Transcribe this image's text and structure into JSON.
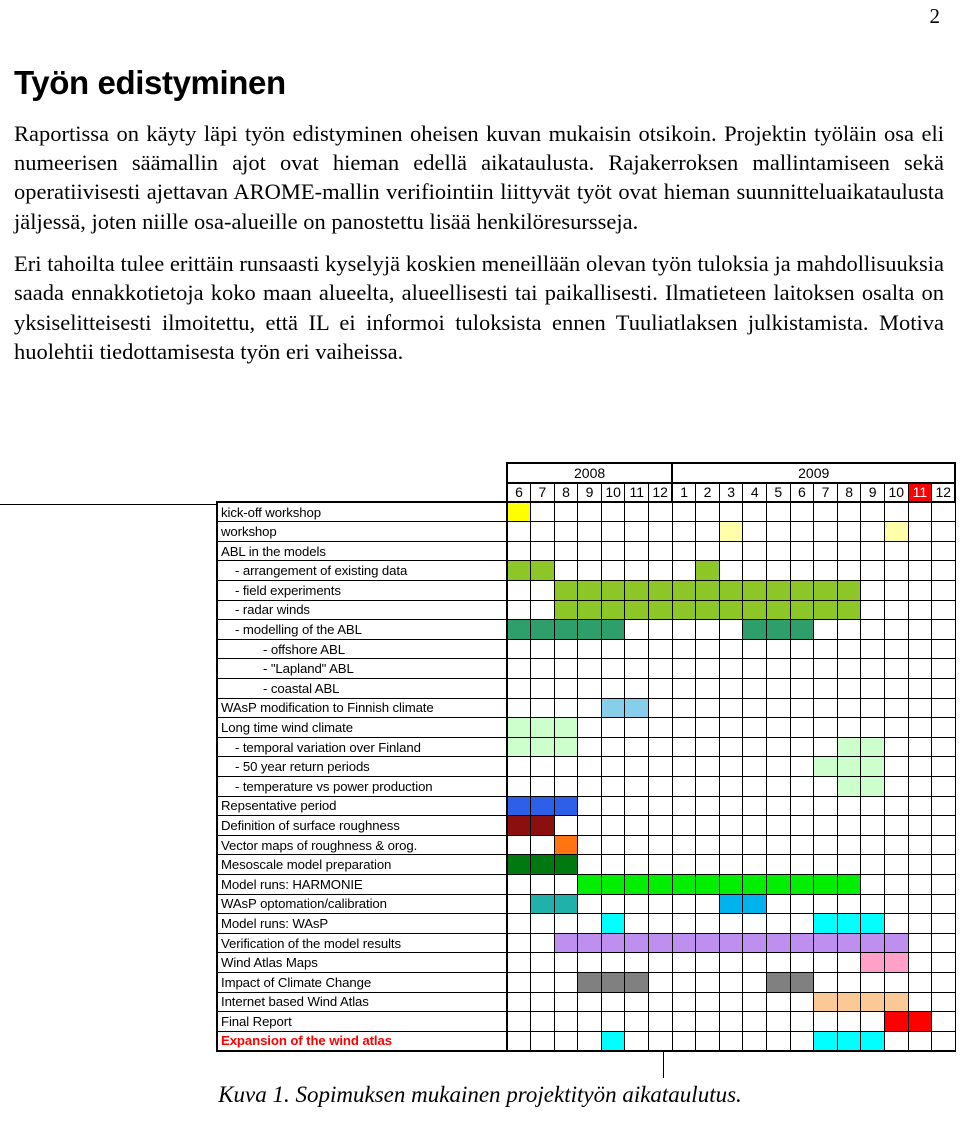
{
  "page_number": "2",
  "document": {
    "title": "Työn edistyminen",
    "paragraphs": [
      "Raportissa on käyty läpi työn edistyminen oheisen kuvan mukaisin otsikoin. Projektin työläin osa eli numeerisen säämallin ajot ovat hieman edellä aikataulusta. Rajakerroksen mallintamiseen sekä operatiivisesti ajettavan AROME-mallin verifiointiin liittyvät työt ovat hieman suunnitteluaikataulusta jäljessä, joten niille osa-alueille on panostettu lisää henkilöresursseja.",
      "Eri tahoilta tulee erittäin runsaasti kyselyjä koskien meneillään olevan työn tuloksia ja mahdollisuuksia saada ennakkotietoja koko maan alueelta, alueellisesti tai paikallisesti. Ilmatieteen laitoksen osalta on yksiselitteisesti ilmoitettu, että IL ei informoi tuloksista ennen Tuuliatlaksen julkistamista. Motiva huolehtii tiedottamisesta työn eri vaiheissa."
    ],
    "caption": "Kuva 1. Sopimuksen mukainen projektityön aikataulutus."
  },
  "chart_data": {
    "type": "gantt",
    "title": "Sopimuksen mukainen projektityön aikataulutus",
    "years": [
      {
        "label": "2008",
        "span": 7
      },
      {
        "label": "2009",
        "span": 12
      }
    ],
    "months": [
      "6",
      "7",
      "8",
      "9",
      "10",
      "11",
      "12",
      "1",
      "2",
      "3",
      "4",
      "5",
      "6",
      "7",
      "8",
      "9",
      "10",
      "11",
      "12"
    ],
    "highlighted_month_index": 17,
    "highlight_color": "#ff0000",
    "year_divider_index": 7,
    "colors": {
      "yellow": "#ffff00",
      "pale_yellow": "#ffffaa",
      "yellow_green": "#8cc727",
      "sea_green": "#2e9e6b",
      "light_blue": "#87ceeb",
      "pale_green": "#ccffcc",
      "blue": "#2d5fe8",
      "dark_red": "#8b0f0f",
      "orange": "#ff7410",
      "dark_green": "#007a10",
      "bright_green": "#00ee00",
      "teal": "#20b2aa",
      "deep_sky": "#00b2ee",
      "cyan": "#00ffff",
      "purple": "#bf8fef",
      "pink": "#ffa0c8",
      "gray": "#808080",
      "peach": "#fac996",
      "red": "#ff0000"
    },
    "tasks": [
      {
        "label": "kick-off workshop",
        "indent": 0,
        "emphasis": false,
        "bars": [
          {
            "start": 0,
            "end": 0,
            "color": "#ffff00"
          }
        ]
      },
      {
        "label": "workshop",
        "indent": 0,
        "emphasis": false,
        "bars": [
          {
            "start": 9,
            "end": 9,
            "color": "#ffffaa"
          },
          {
            "start": 16,
            "end": 16,
            "color": "#ffffaa"
          }
        ]
      },
      {
        "label": "ABL in the models",
        "indent": 0,
        "emphasis": false,
        "bars": []
      },
      {
        "label": "- arrangement of existing data",
        "indent": 1,
        "emphasis": false,
        "bars": [
          {
            "start": 0,
            "end": 1,
            "color": "#8cc727"
          },
          {
            "start": 8,
            "end": 8,
            "color": "#8cc727"
          }
        ]
      },
      {
        "label": "- field experiments",
        "indent": 1,
        "emphasis": false,
        "bars": [
          {
            "start": 2,
            "end": 14,
            "color": "#8cc727"
          }
        ]
      },
      {
        "label": "- radar winds",
        "indent": 1,
        "emphasis": false,
        "bars": [
          {
            "start": 2,
            "end": 14,
            "color": "#8cc727"
          }
        ]
      },
      {
        "label": "- modelling of the ABL",
        "indent": 1,
        "emphasis": false,
        "bars": [
          {
            "start": 0,
            "end": 4,
            "color": "#2e9e6b"
          },
          {
            "start": 10,
            "end": 12,
            "color": "#2e9e6b"
          }
        ]
      },
      {
        "label": "- offshore ABL",
        "indent": 2,
        "emphasis": false,
        "bars": []
      },
      {
        "label": "- \"Lapland\" ABL",
        "indent": 2,
        "emphasis": false,
        "bars": []
      },
      {
        "label": "- coastal  ABL",
        "indent": 2,
        "emphasis": false,
        "bars": []
      },
      {
        "label": "WAsP modification to Finnish climate",
        "indent": 0,
        "emphasis": false,
        "bars": [
          {
            "start": 4,
            "end": 5,
            "color": "#87ceeb"
          }
        ]
      },
      {
        "label": "Long time wind climate",
        "indent": 0,
        "emphasis": false,
        "bars": [
          {
            "start": 0,
            "end": 2,
            "color": "#ccffcc"
          }
        ]
      },
      {
        "label": "- temporal variation over Finland",
        "indent": 1,
        "emphasis": false,
        "bars": [
          {
            "start": 0,
            "end": 2,
            "color": "#ccffcc"
          },
          {
            "start": 14,
            "end": 15,
            "color": "#ccffcc"
          }
        ]
      },
      {
        "label": "- 50 year return periods",
        "indent": 1,
        "emphasis": false,
        "bars": [
          {
            "start": 13,
            "end": 15,
            "color": "#ccffcc"
          }
        ]
      },
      {
        "label": "- temperature vs power production",
        "indent": 1,
        "emphasis": false,
        "bars": [
          {
            "start": 14,
            "end": 15,
            "color": "#ccffcc"
          }
        ]
      },
      {
        "label": "Repsentative period",
        "indent": 0,
        "emphasis": false,
        "bars": [
          {
            "start": 0,
            "end": 2,
            "color": "#2d5fe8"
          }
        ]
      },
      {
        "label": "Definition of surface roughness",
        "indent": 0,
        "emphasis": false,
        "bars": [
          {
            "start": 0,
            "end": 1,
            "color": "#8b0f0f"
          }
        ]
      },
      {
        "label": "Vector maps of roughness & orog.",
        "indent": 0,
        "emphasis": false,
        "bars": [
          {
            "start": 2,
            "end": 2,
            "color": "#ff7410"
          }
        ]
      },
      {
        "label": "Mesoscale model preparation",
        "indent": 0,
        "emphasis": false,
        "bars": [
          {
            "start": 0,
            "end": 2,
            "color": "#007a10"
          }
        ]
      },
      {
        "label": "Model runs:  HARMONIE",
        "indent": 0,
        "emphasis": false,
        "bars": [
          {
            "start": 3,
            "end": 14,
            "color": "#00ee00"
          }
        ]
      },
      {
        "label": "WAsP optomation/calibration",
        "indent": 0,
        "emphasis": false,
        "bars": [
          {
            "start": 1,
            "end": 2,
            "color": "#20b2aa"
          },
          {
            "start": 9,
            "end": 10,
            "color": "#00b2ee"
          }
        ]
      },
      {
        "label": "Model runs:  WAsP",
        "indent": 0,
        "emphasis": false,
        "bars": [
          {
            "start": 4,
            "end": 4,
            "color": "#00ffff"
          },
          {
            "start": 13,
            "end": 15,
            "color": "#00ffff"
          }
        ]
      },
      {
        "label": "Verification of the model results",
        "indent": 0,
        "emphasis": false,
        "bars": [
          {
            "start": 2,
            "end": 16,
            "color": "#bf8fef"
          }
        ]
      },
      {
        "label": "Wind Atlas Maps",
        "indent": 0,
        "emphasis": false,
        "bars": [
          {
            "start": 15,
            "end": 16,
            "color": "#ffa0c8"
          }
        ]
      },
      {
        "label": "Impact of Climate Change",
        "indent": 0,
        "emphasis": false,
        "bars": [
          {
            "start": 3,
            "end": 5,
            "color": "#808080"
          },
          {
            "start": 11,
            "end": 12,
            "color": "#808080"
          }
        ]
      },
      {
        "label": "Internet based Wind Atlas",
        "indent": 0,
        "emphasis": false,
        "bars": [
          {
            "start": 13,
            "end": 16,
            "color": "#fac996"
          }
        ]
      },
      {
        "label": "Final Report",
        "indent": 0,
        "emphasis": false,
        "bars": [
          {
            "start": 16,
            "end": 17,
            "color": "#ff0000"
          }
        ]
      },
      {
        "label": "Expansion of the wind atlas",
        "indent": 0,
        "emphasis": true,
        "bars": [
          {
            "start": 4,
            "end": 4,
            "color": "#00ffff"
          },
          {
            "start": 13,
            "end": 15,
            "color": "#00ffff"
          }
        ]
      }
    ]
  }
}
